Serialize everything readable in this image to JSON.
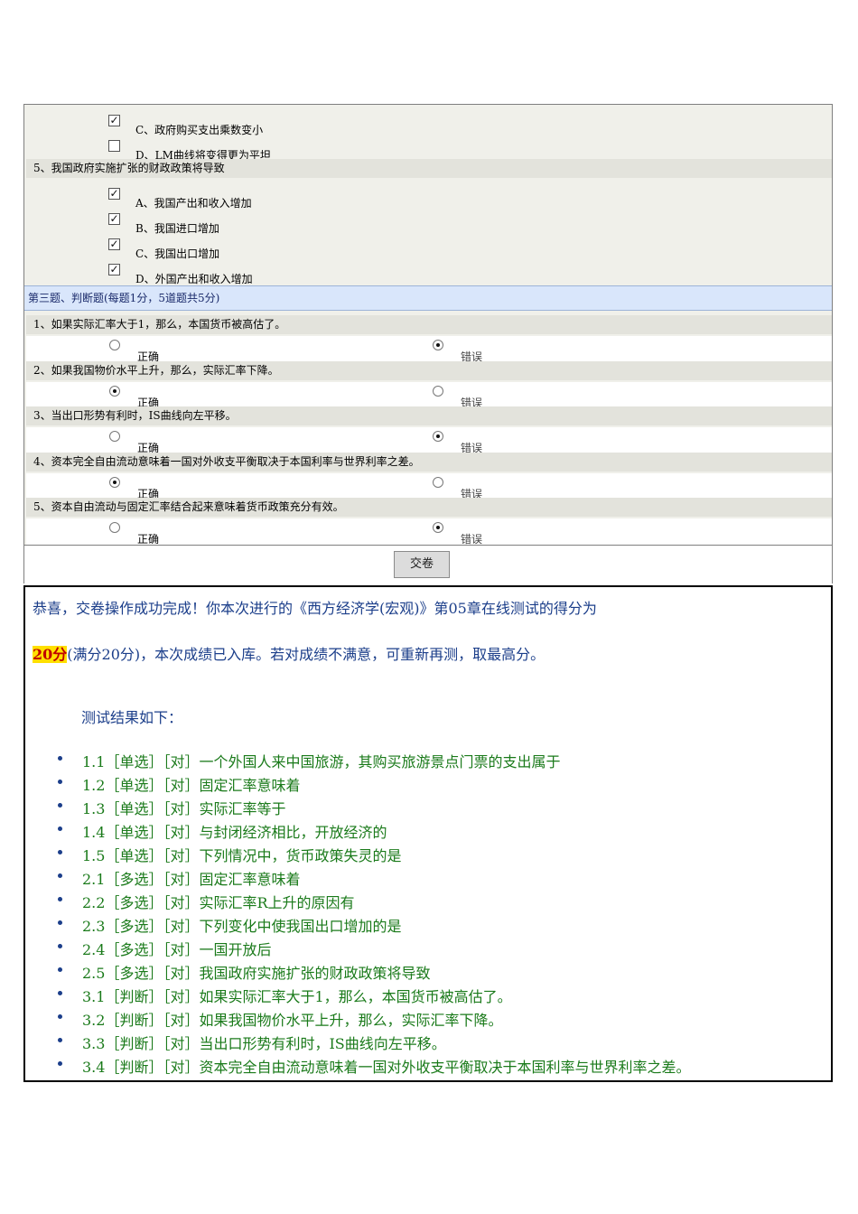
{
  "quiz": {
    "q4_partial_options": [
      {
        "label": "C、政府购买支出乘数变小",
        "checked": true
      },
      {
        "label": "D、LM曲线将变得更为平坦",
        "checked": false
      }
    ],
    "q5": {
      "question": "5、我国政府实施扩张的财政政策将导致",
      "options": [
        {
          "label": "A、我国产出和收入增加",
          "checked": true
        },
        {
          "label": "B、我国进口增加",
          "checked": true
        },
        {
          "label": "C、我国出口增加",
          "checked": true
        },
        {
          "label": "D、外国产出和收入增加",
          "checked": true
        }
      ]
    },
    "section3_header": "第三题、判断题(每题1分，5道题共5分)",
    "true_label": "正确",
    "false_label": "错误",
    "tf_questions": [
      {
        "text": "1、如果实际汇率大于1，那么，本国货币被高估了。",
        "selected": "false"
      },
      {
        "text": "2、如果我国物价水平上升，那么，实际汇率下降。",
        "selected": "true"
      },
      {
        "text": "3、当出口形势有利时，IS曲线向左平移。",
        "selected": "false"
      },
      {
        "text": "4、资本完全自由流动意味着一国对外收支平衡取决于本国利率与世界利率之差。",
        "selected": "true"
      },
      {
        "text": "5、资本自由流动与固定汇率结合起来意味着货币政策充分有效。",
        "selected": "false"
      }
    ],
    "submit_label": "交卷"
  },
  "result": {
    "line1": "恭喜，交卷操作成功完成！你本次进行的《西方经济学(宏观)》第05章在线测试的得分为",
    "score": "20分",
    "line2_rest": "(满分20分)，本次成绩已入库。若对成绩不满意，可重新再测，取最高分。",
    "heading": "测试结果如下：",
    "items": [
      "1.1［单选］［对］一个外国人来中国旅游，其购买旅游景点门票的支出属于",
      "1.2［单选］［对］固定汇率意味着",
      "1.3［单选］［对］实际汇率等于",
      "1.4［单选］［对］与封闭经济相比，开放经济的",
      "1.5［单选］［对］下列情况中，货币政策失灵的是",
      "2.1［多选］［对］固定汇率意味着",
      "2.2［多选］［对］实际汇率R上升的原因有",
      "2.3［多选］［对］下列变化中使我国出口增加的是",
      "2.4［多选］［对］一国开放后",
      "2.5［多选］［对］我国政府实施扩张的财政政策将导致",
      "3.1［判断］［对］如果实际汇率大于1，那么，本国货币被高估了。",
      "3.2［判断］［对］如果我国物价水平上升，那么，实际汇率下降。",
      "3.3［判断］［对］当出口形势有利时，IS曲线向左平移。",
      "3.4［判断］［对］资本完全自由流动意味着一国对外收支平衡取决于本国利率与世界利率之差。"
    ]
  }
}
